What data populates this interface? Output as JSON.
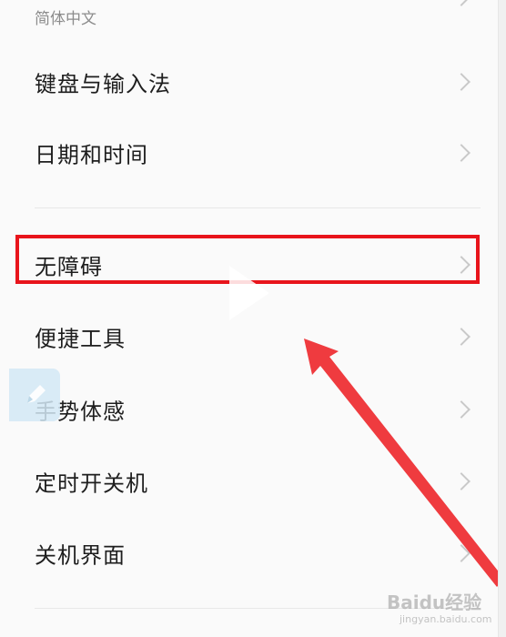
{
  "header": {
    "subtitle": "简体中文"
  },
  "settings": {
    "items": [
      {
        "label": "键盘与输入法"
      },
      {
        "label": "日期和时间"
      },
      {
        "label": "无障碍"
      },
      {
        "label": "便捷工具"
      },
      {
        "label": "手势体感"
      },
      {
        "label": "定时开关机"
      },
      {
        "label": "关机界面"
      }
    ]
  },
  "annotation": {
    "highlight_color": "#e8141b",
    "highlighted_item": "无障碍"
  },
  "watermark": {
    "brand": "Baidu经验",
    "sub": "jingyan.baidu.com"
  },
  "icons": {
    "row_chevron": "chevron-right-icon",
    "overlay_play": "play-icon",
    "floating_edit": "pencil-icon"
  }
}
